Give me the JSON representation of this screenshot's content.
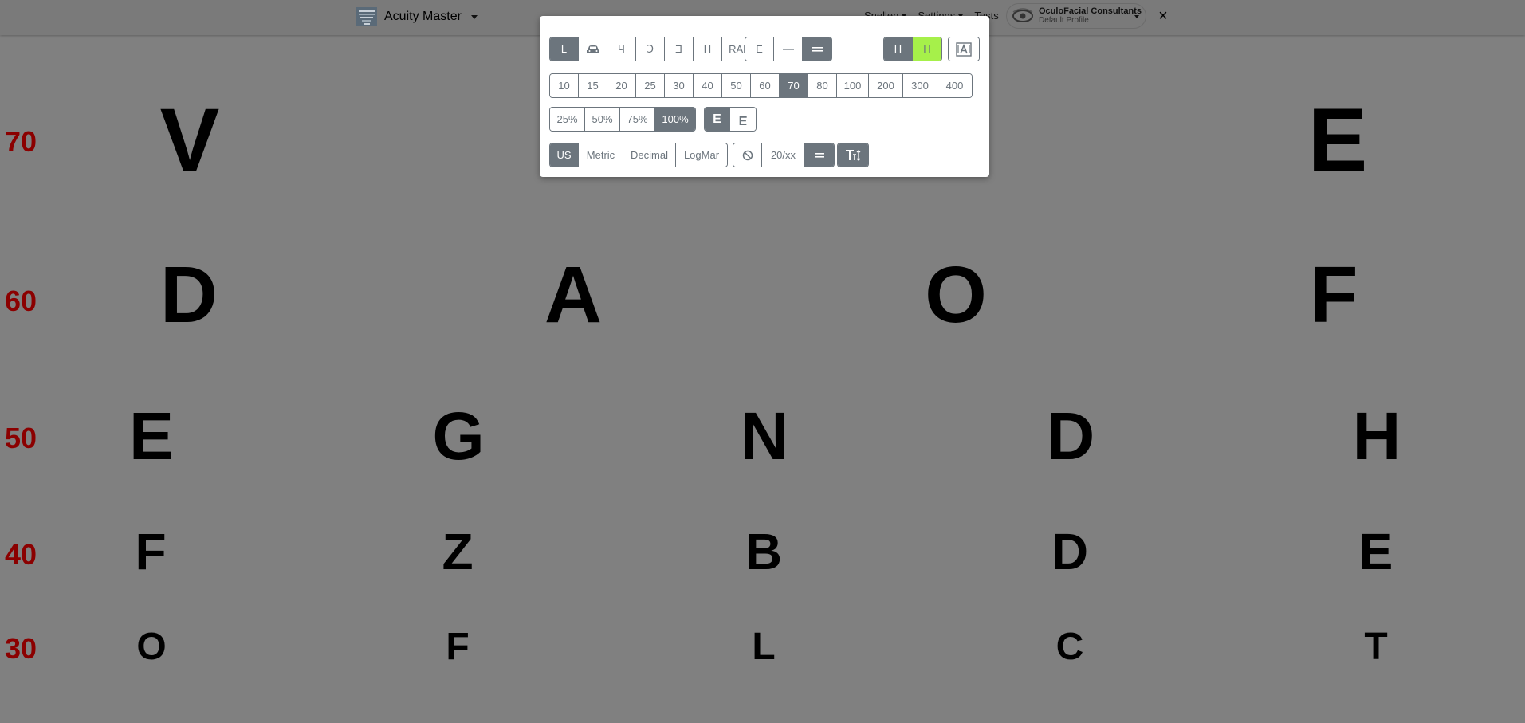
{
  "navbar": {
    "app_title": "Acuity Master",
    "links": [
      {
        "label": "Snellen"
      },
      {
        "label": "Settings"
      },
      {
        "label": "Tests"
      }
    ],
    "profile": {
      "name": "OculoFacial Consultants",
      "subtitle": "Default Profile"
    },
    "close_label": "×"
  },
  "toolbar": {
    "optotype": {
      "letters_label": "L",
      "car_icon": "car-icon",
      "tumbling_e_labels": [
        "Ч",
        "Ↄ",
        "Ǝ",
        "Η"
      ],
      "random_label": "RANDOM"
    },
    "line_mode": {
      "single_label": "E",
      "line_icon": "single-line-icon",
      "double_icon": "double-line-icon"
    },
    "contrast": {
      "dark_label": "H",
      "lime_label": "H"
    },
    "text_icon": "text-frame-icon",
    "sizes": [
      "10",
      "15",
      "20",
      "25",
      "30",
      "40",
      "50",
      "60",
      "70",
      "80",
      "100",
      "200",
      "300",
      "400"
    ],
    "selected_size": "70",
    "contrast_percent": [
      "25%",
      "50%",
      "75%",
      "100%"
    ],
    "selected_contrast": "100%",
    "mirror": {
      "normal_label": "E",
      "mirror_label": "E"
    },
    "units": [
      "US",
      "Metric",
      "Decimal",
      "LogMar"
    ],
    "selected_unit": "US",
    "notation": {
      "hide_icon": "no-symbol-icon",
      "format_label": "20/xx",
      "equals_icon": "equals-icon"
    },
    "text_size_icon": "text-size-icon"
  },
  "chart": {
    "rows": [
      {
        "label": "70",
        "letters": [
          "V",
          "E"
        ]
      },
      {
        "label": "60",
        "letters": [
          "D",
          "A",
          "O",
          "F"
        ]
      },
      {
        "label": "50",
        "letters": [
          "E",
          "G",
          "N",
          "D",
          "H"
        ]
      },
      {
        "label": "40",
        "letters": [
          "F",
          "Z",
          "B",
          "D",
          "E"
        ]
      },
      {
        "label": "30",
        "letters": [
          "O",
          "F",
          "L",
          "C",
          "T"
        ]
      }
    ]
  }
}
